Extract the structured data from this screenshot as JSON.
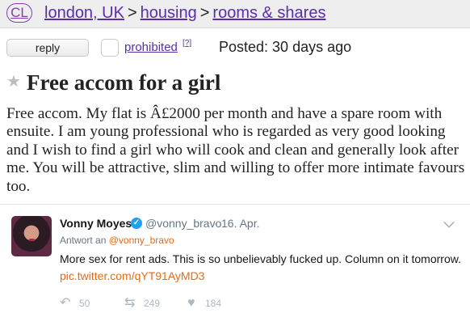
{
  "header": {
    "logo": "CL",
    "breadcrumb": {
      "location": "london, UK",
      "sep1": ">",
      "category": "housing",
      "sep2": ">",
      "subcategory": "rooms & shares"
    }
  },
  "actions": {
    "reply_label": "reply",
    "flag_label": "prohibited",
    "help_label": "[?]",
    "posted": "Posted: 30 days ago"
  },
  "post": {
    "title": "Free accom for a girl",
    "body": "Free accom. My flat is Â£2000 per month and have a spare room with ensuite. I am young professional who is regarded as very good looking and I wish to find a girl who will cook and clean and generally look after me. You will be attractive, slim and willing to offer more intimate favours too."
  },
  "tweet": {
    "name": "Vonny Moyes",
    "handle": "@vonny_bravo",
    "dot": "·",
    "date": "16. Apr.",
    "reply_prefix": "Antwort an",
    "reply_mention": "@vonny_bravo",
    "text": "More sex for rent ads. This is so unbelievably fucked up. Column on it tomorrow.",
    "link": "pic.twitter.com/qYT91AyMD3",
    "replies": "50",
    "retweets": "249",
    "likes": "184"
  },
  "colors": {
    "link": "#5a2ea6",
    "tweet_accent": "#e86a13",
    "verified": "#1da1f2"
  },
  "icons": [
    "star-icon",
    "verified-badge-icon",
    "chevron-down-icon",
    "reply-icon",
    "retweet-icon",
    "heart-icon"
  ]
}
